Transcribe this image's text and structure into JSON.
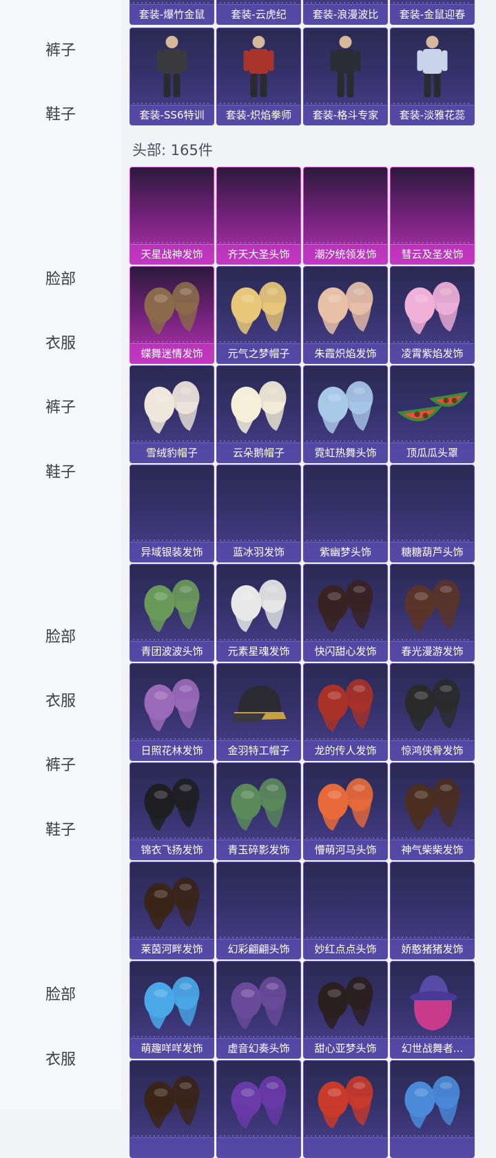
{
  "sidebar": {
    "items": [
      {
        "label": "裤子"
      },
      {
        "label": "鞋子"
      },
      {
        "label": "脸部"
      },
      {
        "label": "衣服"
      },
      {
        "label": "裤子"
      },
      {
        "label": "鞋子"
      },
      {
        "label": "脸部"
      },
      {
        "label": "衣服"
      },
      {
        "label": "裤子"
      },
      {
        "label": "鞋子"
      },
      {
        "label": "脸部"
      },
      {
        "label": "衣服"
      }
    ]
  },
  "section": {
    "heading": "头部: 165件"
  },
  "cards": [
    {
      "label": "套装-爆竹金鼠",
      "icon": "outfit-icon",
      "rarity": "epic"
    },
    {
      "label": "套装-云虎纪",
      "icon": "outfit-icon",
      "rarity": "epic"
    },
    {
      "label": "套装-浪漫波比",
      "icon": "outfit-icon",
      "rarity": "epic"
    },
    {
      "label": "套装-金鼠迎春",
      "icon": "outfit-icon",
      "rarity": "epic"
    },
    {
      "label": "套装-SS6特训",
      "icon": "outfit-icon",
      "rarity": "epic",
      "color": "#3a3a3e"
    },
    {
      "label": "套装-炽焰拳师",
      "icon": "outfit-icon",
      "rarity": "epic",
      "color": "#a8352c"
    },
    {
      "label": "套装-格斗专家",
      "icon": "outfit-icon",
      "rarity": "epic",
      "color": "#2a2c36"
    },
    {
      "label": "套装-淡雅花蕊",
      "icon": "outfit-icon",
      "rarity": "epic",
      "color": "#c9d3ea"
    },
    {
      "label": "天星战神发饰",
      "icon": "hair-icon",
      "rarity": "legendary",
      "color": ""
    },
    {
      "label": "齐天大圣头饰",
      "icon": "hair-icon",
      "rarity": "legendary",
      "color": ""
    },
    {
      "label": "潮汐统领发饰",
      "icon": "hair-icon",
      "rarity": "legendary",
      "color": ""
    },
    {
      "label": "彗云及圣发饰",
      "icon": "hair-icon",
      "rarity": "legendary",
      "color": ""
    },
    {
      "label": "蝶舞迷情发饰",
      "icon": "hair-icon",
      "rarity": "legendary",
      "color": "#8a6a4a"
    },
    {
      "label": "元气之梦帽子",
      "icon": "hat-icon",
      "rarity": "epic",
      "color": "#e8c878"
    },
    {
      "label": "朱霞炽焰发饰",
      "icon": "hair-icon",
      "rarity": "epic",
      "color": "#e8c0a8"
    },
    {
      "label": "凌霄紫焰发饰",
      "icon": "hair-icon",
      "rarity": "epic",
      "color": "#f0b0d8"
    },
    {
      "label": "雪绒豹帽子",
      "icon": "hat-icon",
      "rarity": "epic",
      "color": "#f0e6dc"
    },
    {
      "label": "云朵鹅帽子",
      "icon": "hat-icon",
      "rarity": "epic",
      "color": "#f5eed8"
    },
    {
      "label": "霓虹热舞头饰",
      "icon": "hair-icon",
      "rarity": "epic",
      "color": "#a8c8e8"
    },
    {
      "label": "顶瓜瓜头罩",
      "icon": "watermelon-icon",
      "rarity": "epic",
      "color": "#e8503a"
    },
    {
      "label": "异域银装发饰",
      "icon": "hair-icon",
      "rarity": "epic",
      "color": ""
    },
    {
      "label": "蓝冰羽发饰",
      "icon": "hair-icon",
      "rarity": "epic",
      "color": ""
    },
    {
      "label": "紫幽梦头饰",
      "icon": "hair-icon",
      "rarity": "epic",
      "color": ""
    },
    {
      "label": "糖糖葫芦头饰",
      "icon": "hair-icon",
      "rarity": "epic",
      "color": ""
    },
    {
      "label": "青团波波头饰",
      "icon": "hair-icon",
      "rarity": "epic",
      "color": "#6a9a5a"
    },
    {
      "label": "元素星魂发饰",
      "icon": "hair-icon",
      "rarity": "epic",
      "color": "#e8e8e8"
    },
    {
      "label": "快闪甜心发饰",
      "icon": "hair-icon",
      "rarity": "epic",
      "color": "#3a2222"
    },
    {
      "label": "春光漫游发饰",
      "icon": "hair-icon",
      "rarity": "epic",
      "color": "#5a3428"
    },
    {
      "label": "日照花林发饰",
      "icon": "hair-icon",
      "rarity": "epic",
      "color": "#9a6ab8"
    },
    {
      "label": "金羽特工帽子",
      "icon": "cap-icon",
      "rarity": "epic",
      "color": "#2a2a30"
    },
    {
      "label": "龙的传人发饰",
      "icon": "hair-icon",
      "rarity": "epic",
      "color": "#a83228"
    },
    {
      "label": "惊鸿侠骨发饰",
      "icon": "hair-icon",
      "rarity": "epic",
      "color": "#2a2a2a"
    },
    {
      "label": "锦衣飞扬发饰",
      "icon": "hair-icon",
      "rarity": "epic",
      "color": "#1e1e22"
    },
    {
      "label": "青玉碎影发饰",
      "icon": "hair-icon",
      "rarity": "epic",
      "color": "#5a8a5a"
    },
    {
      "label": "懵萌河马头饰",
      "icon": "hair-icon",
      "rarity": "epic",
      "color": "#e86a3a"
    },
    {
      "label": "神气柴柴发饰",
      "icon": "hair-icon",
      "rarity": "epic",
      "color": "#4a2e20"
    },
    {
      "label": "莱茵河畔发饰",
      "icon": "hair-icon",
      "rarity": "epic",
      "color": "#3a2418"
    },
    {
      "label": "幻彩翩翩头饰",
      "icon": "hair-icon",
      "rarity": "epic",
      "color": ""
    },
    {
      "label": "妙红点点头饰",
      "icon": "hair-icon",
      "rarity": "epic",
      "color": ""
    },
    {
      "label": "娇憨猪猪发饰",
      "icon": "hair-icon",
      "rarity": "epic",
      "color": ""
    },
    {
      "label": "萌趣咩咩发饰",
      "icon": "hair-icon",
      "rarity": "epic",
      "color": "#4aa8e8"
    },
    {
      "label": "虚音幻奏头饰",
      "icon": "hair-icon",
      "rarity": "epic",
      "color": "#6a4a9a"
    },
    {
      "label": "甜心亚梦头饰",
      "icon": "hair-icon",
      "rarity": "epic",
      "color": "#2a1e1e"
    },
    {
      "label": "幻世战舞者...",
      "icon": "bucket-hat-icon",
      "rarity": "epic",
      "color": "#c83a8a"
    },
    {
      "label": "",
      "icon": "hair-icon",
      "rarity": "epic",
      "color": "#3a2418"
    },
    {
      "label": "",
      "icon": "hair-icon",
      "rarity": "epic",
      "color": "#6a3aa8"
    },
    {
      "label": "",
      "icon": "hair-icon",
      "rarity": "epic",
      "color": "#c83a2a"
    },
    {
      "label": "",
      "icon": "hair-icon",
      "rarity": "epic",
      "color": "#4a8ad8"
    }
  ]
}
